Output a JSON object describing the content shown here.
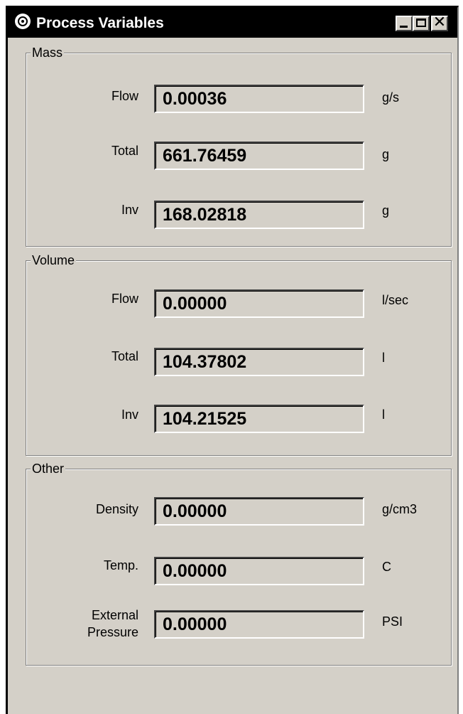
{
  "window": {
    "title": "Process Variables",
    "icon": "app-logo-icon",
    "controls": {
      "minimize_icon": "minimize-icon",
      "maximize_icon": "maximize-icon",
      "close_icon": "close-icon",
      "close_glyph": "✕"
    }
  },
  "groups": {
    "mass": {
      "title": "Mass",
      "rows": [
        {
          "label": "Flow",
          "value": "0.00036",
          "unit": "g/s"
        },
        {
          "label": "Total",
          "value": "661.76459",
          "unit": "g"
        },
        {
          "label": "Inv",
          "value": "168.02818",
          "unit": "g"
        }
      ]
    },
    "volume": {
      "title": "Volume",
      "rows": [
        {
          "label": "Flow",
          "value": "0.00000",
          "unit": "l/sec"
        },
        {
          "label": "Total",
          "value": "104.37802",
          "unit": "l"
        },
        {
          "label": "Inv",
          "value": "104.21525",
          "unit": "l"
        }
      ]
    },
    "other": {
      "title": "Other",
      "rows": [
        {
          "label": "Density",
          "value": "0.00000",
          "unit": "g/cm3"
        },
        {
          "label": "Temp.",
          "value": "0.00000",
          "unit": "C"
        },
        {
          "label_line1": "External",
          "label_line2": "Pressure",
          "value": "0.00000",
          "unit": "PSI"
        }
      ]
    }
  },
  "colors": {
    "titlebar": "#000000",
    "face": "#d4d0c8",
    "text": "#000000"
  }
}
